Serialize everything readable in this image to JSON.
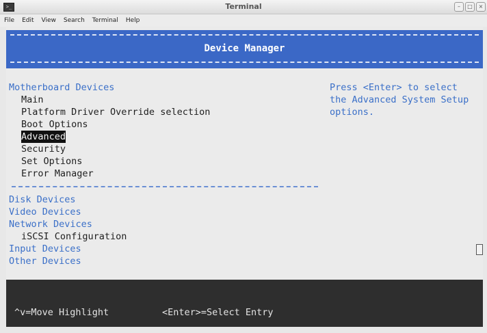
{
  "window": {
    "title": "Terminal",
    "icon": "terminal-icon"
  },
  "menubar": {
    "items": [
      "File",
      "Edit",
      "View",
      "Search",
      "Terminal",
      "Help"
    ]
  },
  "header": {
    "title": "Device Manager"
  },
  "sections": {
    "motherboard": {
      "title": "Motherboard Devices",
      "items": [
        "Main",
        "Platform Driver Override selection",
        "Boot Options",
        "Advanced",
        "Security",
        "Set Options",
        "Error Manager"
      ],
      "selected": "Advanced"
    },
    "other": {
      "disk": "Disk Devices",
      "video": "Video Devices",
      "network": "Network Devices",
      "iscsi": "iSCSI Configuration",
      "input": "Input Devices",
      "other": "Other Devices"
    }
  },
  "help": {
    "text": "Press <Enter> to select the Advanced System Setup options."
  },
  "footer": {
    "move": "^v=Move Highlight",
    "select": "<Enter>=Select Entry"
  },
  "colors": {
    "header_bg": "#3b68c6",
    "link": "#3a6fc8",
    "footer_bg": "#2e2e2e",
    "highlight": "#111111"
  }
}
